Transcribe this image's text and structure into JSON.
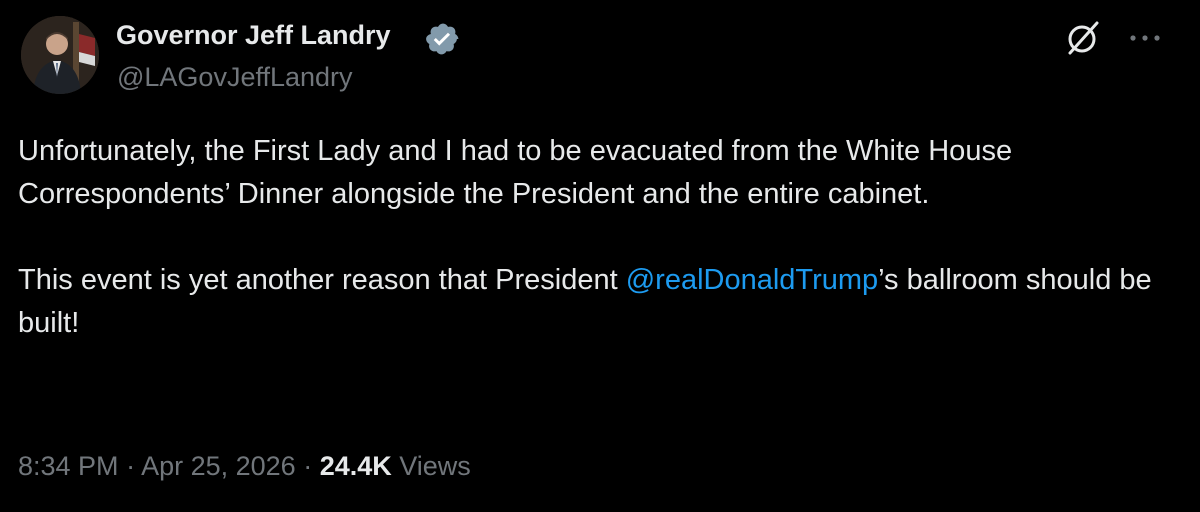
{
  "author": {
    "display_name": "Governor Jeff Landry",
    "handle": "@LAGovJeffLandry",
    "verified_color": "#829aab"
  },
  "tweet": {
    "paragraph1": "Unfortunately, the First Lady and I had to be evacuated from the White House Correspondents’ Dinner alongside the President and the entire cabinet.",
    "paragraph2_prefix": "This event is yet another reason that President ",
    "paragraph2_mention": "@realDonaldTrump",
    "paragraph2_suffix": "’s ballroom should be built!"
  },
  "meta": {
    "time": "8:34 PM",
    "separator": " · ",
    "date": "Apr 25, 2026",
    "views_count": "24.4K",
    "views_label": " Views"
  },
  "icons": {
    "verified": "verified-badge-icon",
    "grok": "grok-icon",
    "more": "more-options-icon"
  },
  "colors": {
    "background": "#000000",
    "text_primary": "#e7e9ea",
    "text_secondary": "#71767b",
    "link": "#1d9bf0"
  }
}
